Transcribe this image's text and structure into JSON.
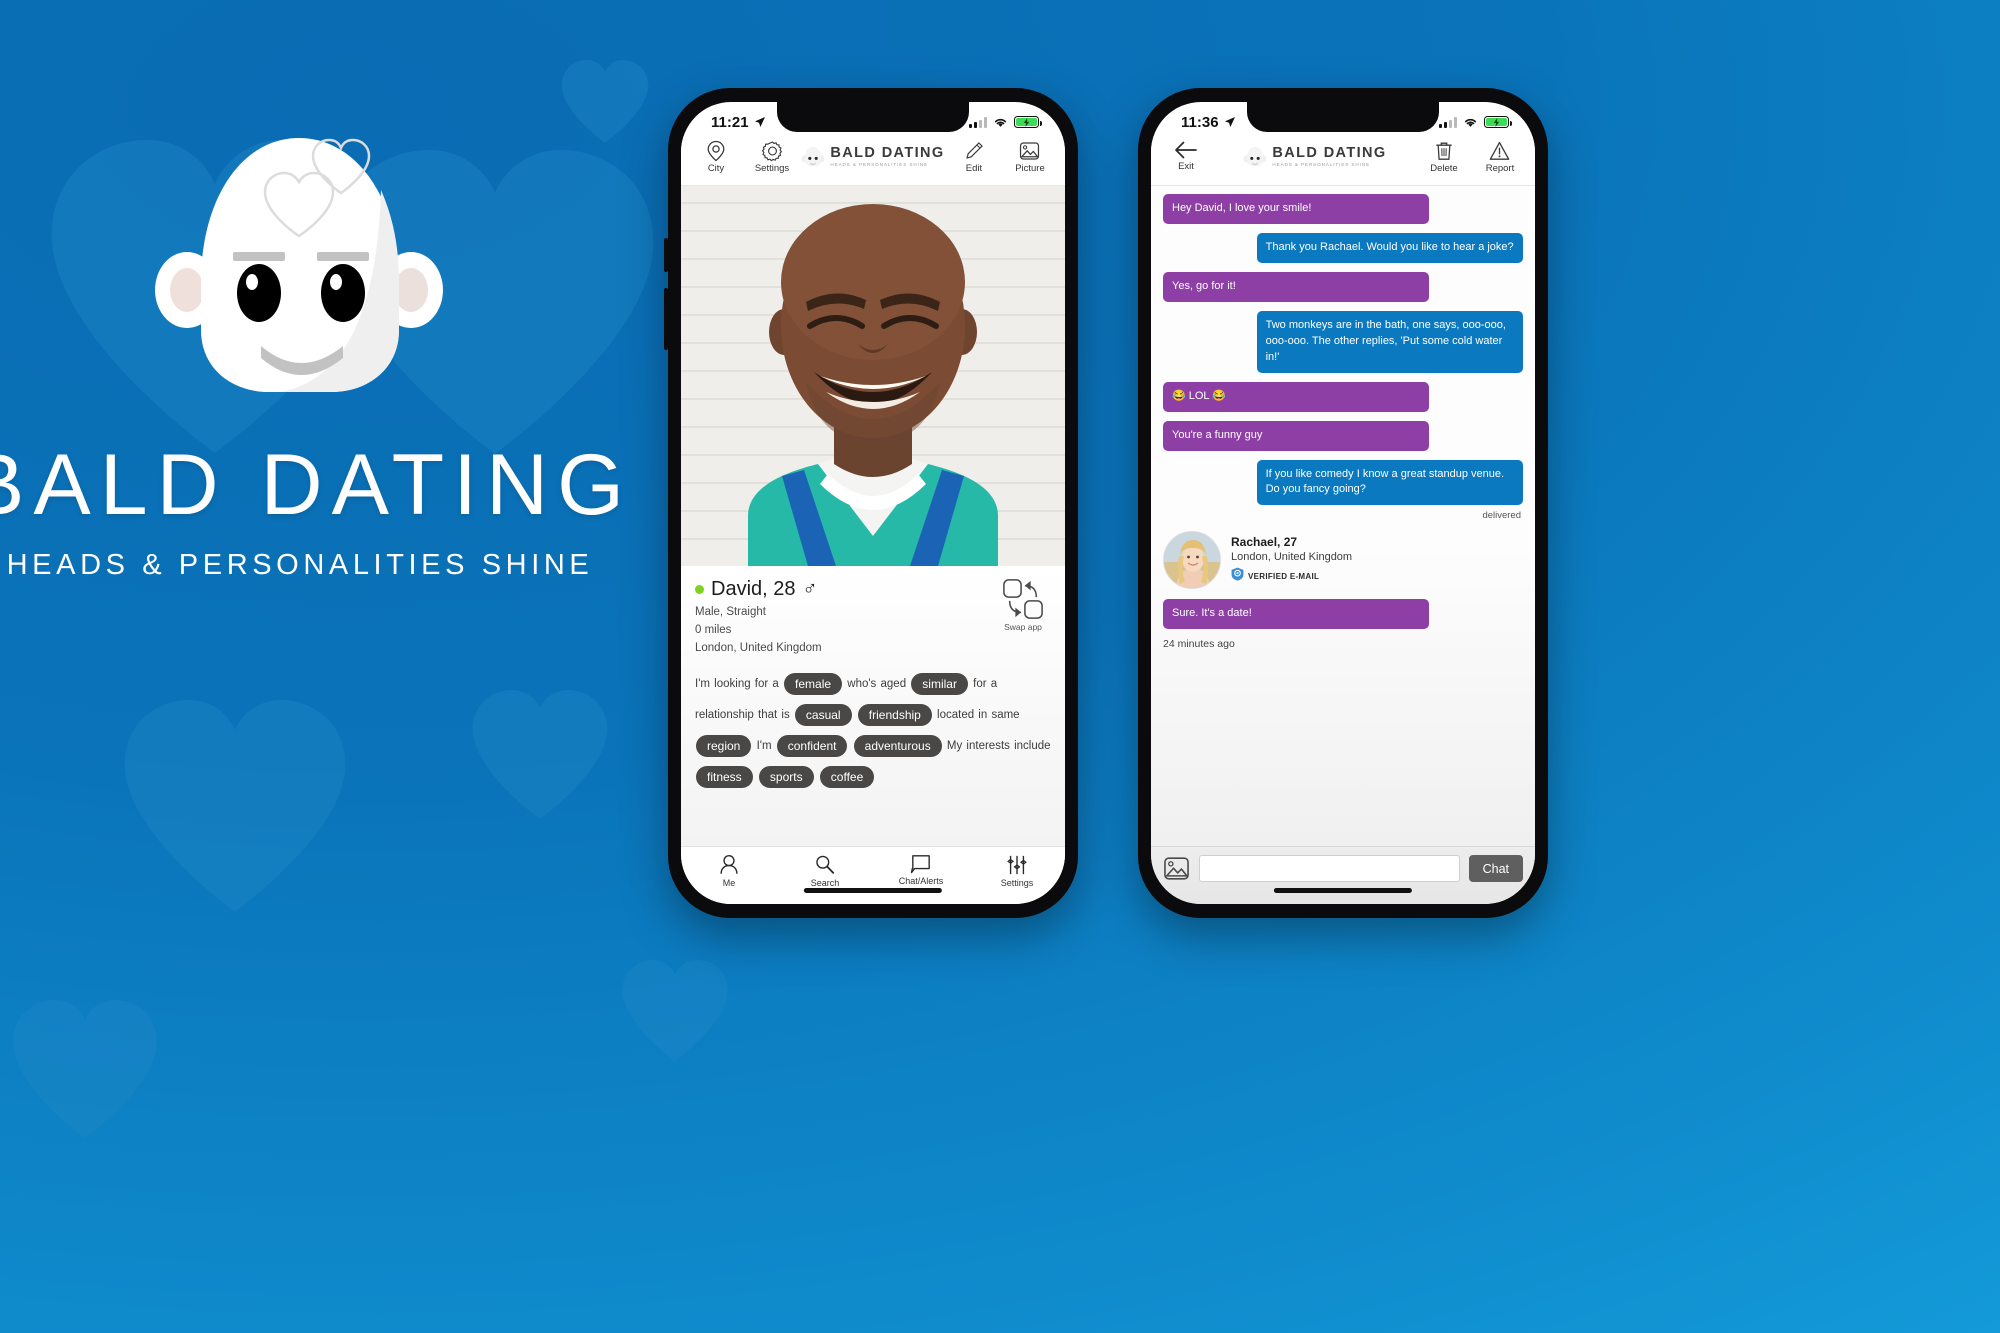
{
  "brand": {
    "title": "BALD DATING",
    "subtitle": "HEADS & PERSONALITIES SHINE",
    "logo_icon": "bald-head-logo-icon",
    "bg_color": "#0a6cb3",
    "bg_color_light": "#17a3e0"
  },
  "phone1": {
    "status": {
      "time": "11:21",
      "location_icon": "location-arrow-icon",
      "signal_icon": "cellular-signal-icon",
      "wifi_icon": "wifi-icon",
      "battery_icon": "battery-charging-icon"
    },
    "app_bar": {
      "left": [
        {
          "icon": "map-pin-icon",
          "label": "City"
        },
        {
          "icon": "gear-icon",
          "label": "Settings"
        }
      ],
      "logo": {
        "icon": "bald-head-logo-icon",
        "title": "BALD DATING",
        "subtitle": "HEADS & PERSONALITIES SHINE"
      },
      "right": [
        {
          "icon": "pencil-icon",
          "label": "Edit"
        },
        {
          "icon": "picture-icon",
          "label": "Picture"
        }
      ]
    },
    "profile": {
      "online": true,
      "name_age": "David, 28",
      "gender_symbol": "♂",
      "gender_orientation": "Male, Straight",
      "distance": "0 miles",
      "location": "London, United Kingdom",
      "swap": {
        "icon": "swap-app-icon",
        "label": "Swap app"
      },
      "bio_parts": [
        {
          "type": "text",
          "value": "I'm looking for a"
        },
        {
          "type": "pill",
          "value": "female"
        },
        {
          "type": "text",
          "value": "who's aged"
        },
        {
          "type": "pill",
          "value": "similar"
        },
        {
          "type": "text",
          "value": "for a relationship that is"
        },
        {
          "type": "pill",
          "value": "casual"
        },
        {
          "type": "pill",
          "value": "friendship"
        },
        {
          "type": "text",
          "value": "located in same"
        },
        {
          "type": "pill",
          "value": "region"
        },
        {
          "type": "text",
          "value": "I'm"
        },
        {
          "type": "pill",
          "value": "confident"
        },
        {
          "type": "pill",
          "value": "adventurous"
        },
        {
          "type": "text",
          "value": "My interests include"
        },
        {
          "type": "pill",
          "value": "fitness"
        },
        {
          "type": "pill",
          "value": "sports"
        },
        {
          "type": "pill",
          "value": "coffee"
        }
      ]
    },
    "tabbar": [
      {
        "icon": "person-icon",
        "label": "Me"
      },
      {
        "icon": "search-icon",
        "label": "Search"
      },
      {
        "icon": "chat-bubble-icon",
        "label": "Chat/Alerts"
      },
      {
        "icon": "sliders-icon",
        "label": "Settings"
      }
    ]
  },
  "phone2": {
    "status": {
      "time": "11:36",
      "location_icon": "location-arrow-icon",
      "signal_icon": "cellular-signal-icon",
      "wifi_icon": "wifi-icon",
      "battery_icon": "battery-charging-icon"
    },
    "app_bar": {
      "left": [
        {
          "icon": "back-arrow-icon",
          "label": "Exit"
        }
      ],
      "logo": {
        "icon": "bald-head-logo-icon",
        "title": "BALD DATING",
        "subtitle": "HEADS & PERSONALITIES SHINE"
      },
      "right": [
        {
          "icon": "trash-icon",
          "label": "Delete"
        },
        {
          "icon": "warning-triangle-icon",
          "label": "Report"
        }
      ]
    },
    "messages": [
      {
        "side": "them",
        "text": "Hey David, I love your smile!"
      },
      {
        "side": "me",
        "text": "Thank you Rachael. Would you like to hear a joke?"
      },
      {
        "side": "them",
        "text": "Yes, go for it!"
      },
      {
        "side": "me",
        "text": "Two monkeys are in the bath, one says, ooo-ooo, ooo-ooo. The other replies, 'Put some cold water in!'"
      },
      {
        "side": "them",
        "text": "😂 LOL 😂"
      },
      {
        "side": "them",
        "text": "You're a funny guy"
      },
      {
        "side": "me",
        "text": "If you like comedy I know a great standup venue. Do you fancy going?"
      }
    ],
    "delivered_label": "delivered",
    "contact": {
      "avatar_icon": "avatar-photo",
      "name_age": "Rachael, 27",
      "location": "London, United Kingdom",
      "verified_icon": "verified-shield-icon",
      "verified_label": "VERIFIED E-MAIL"
    },
    "final_message": {
      "side": "them",
      "text": "Sure. It's a date!"
    },
    "timestamp": "24 minutes ago",
    "composer": {
      "image_icon": "picture-icon",
      "input_value": "",
      "input_placeholder": "",
      "send_label": "Chat"
    },
    "colors": {
      "them_bubble": "#8e3fa5",
      "me_bubble": "#0b79bf",
      "send_button": "#5f5f5f"
    }
  }
}
